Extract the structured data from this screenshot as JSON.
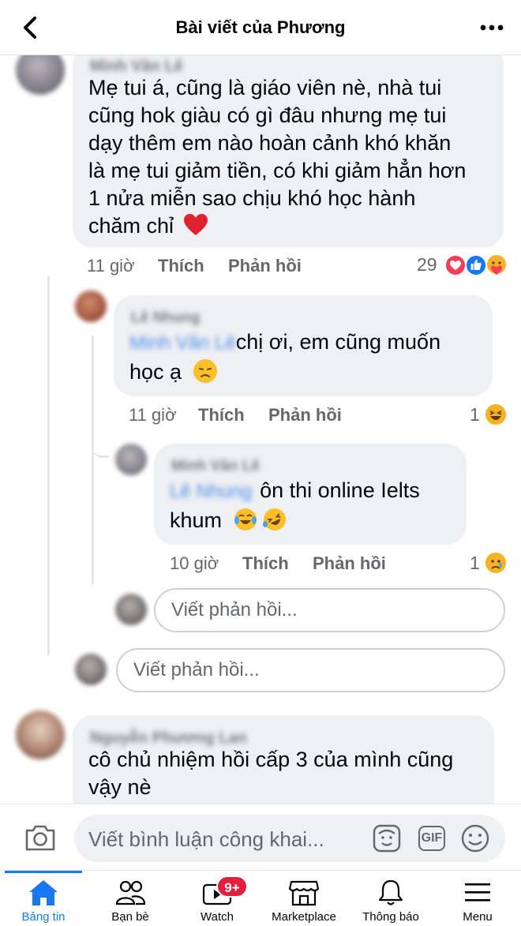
{
  "header": {
    "title": "Bài viết của Phương"
  },
  "comments": [
    {
      "author": "Minh Văn Lê",
      "text": "Mẹ tui á, cũng là giáo viên nè, nhà tui cũng hok giàu có gì đâu nhưng mẹ tui dạy thêm em nào hoàn cảnh khó khăn là mẹ tui giảm tiền, có khi giảm hẳn hơn 1 nửa miễn sao chịu khó học hành chăm chỉ",
      "lines": [
        "Mẹ tui á, cũng là giáo viên nè, nhà tui",
        "cũng hok giàu có gì đâu nhưng mẹ tui",
        "dạy thêm em nào hoàn cảnh khó khăn",
        "là mẹ tui giảm tiền, có khi giảm hẳn hơn",
        "1 nửa miễn sao chịu khó học hành",
        "chăm chỉ"
      ],
      "time": "11 giờ",
      "like_label": "Thích",
      "reply_label": "Phản hồi",
      "reaction_count": "29",
      "reactions": [
        "heart-icon",
        "like-icon",
        "care-icon"
      ]
    },
    {
      "author": "Lê Nhung",
      "mention": "Minh Văn Lê",
      "text_line1": "chị ơi, em cũng muốn",
      "text_line2": "học ạ",
      "time": "11 giờ",
      "like_label": "Thích",
      "reply_label": "Phản hồi",
      "reaction_count": "1",
      "reactions": [
        "haha-icon"
      ]
    },
    {
      "author": "Minh Văn Lê",
      "mention": "Lê Nhung",
      "text_line1": "ôn thi online Ielts",
      "text_line2": "khum",
      "time": "10 giờ",
      "like_label": "Thích",
      "reply_label": "Phản hồi",
      "reaction_count": "1",
      "reactions": [
        "sad-icon"
      ]
    },
    {
      "author": "Nguyễn Phương Lan",
      "lines": [
        "cô chủ nhiệm hồi cấp 3 của mình cũng",
        "vậy nè"
      ]
    }
  ],
  "reply_inputs": {
    "nested_placeholder": "Viết phản hồi...",
    "thread_placeholder": "Viết phản hồi..."
  },
  "comment_bar": {
    "placeholder": "Viết bình luận công khai...",
    "gif_label": "GIF"
  },
  "nav": [
    {
      "label": "Bảng tin",
      "icon": "home-icon",
      "active": true
    },
    {
      "label": "Bạn bè",
      "icon": "friends-icon"
    },
    {
      "label": "Watch",
      "icon": "watch-icon",
      "badge": "9+"
    },
    {
      "label": "Marketplace",
      "icon": "marketplace-icon"
    },
    {
      "label": "Thông báo",
      "icon": "bell-icon"
    },
    {
      "label": "Menu",
      "icon": "menu-icon"
    }
  ],
  "colors": {
    "accent": "#1877f2",
    "bubble": "#eff0f3",
    "badge": "#e41e3f",
    "meta_text": "#65676b"
  }
}
